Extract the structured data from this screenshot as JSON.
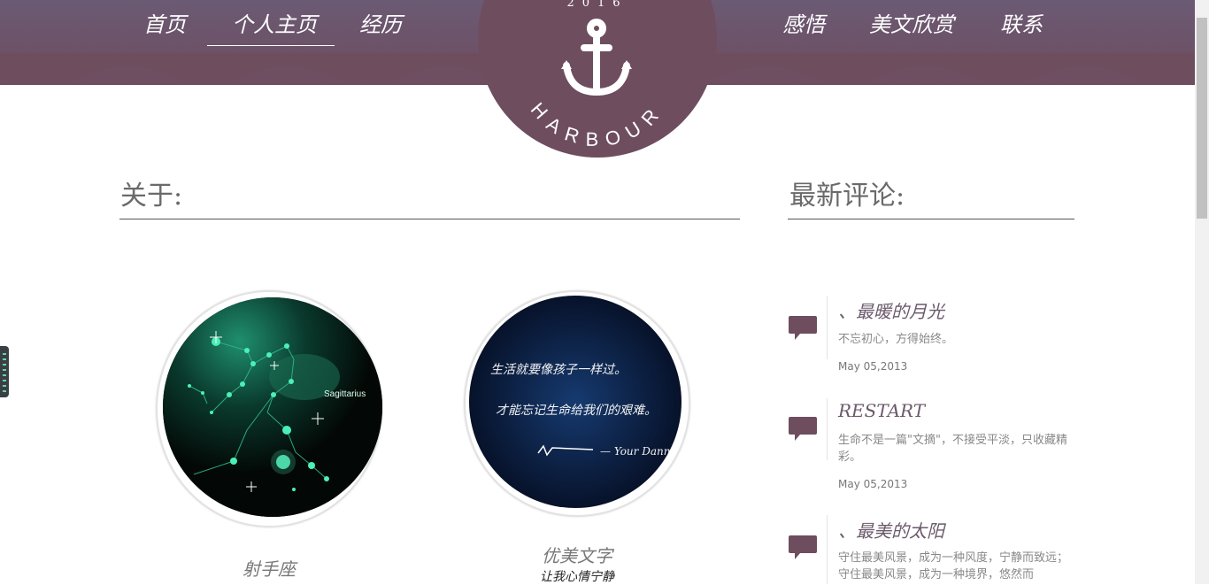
{
  "nav": {
    "left": [
      "首页",
      "个人主页",
      "经历"
    ],
    "right": [
      "感悟",
      "美文欣赏",
      "联系"
    ]
  },
  "logo": {
    "year": "2016",
    "name": "HARBOUR"
  },
  "about": {
    "title": "关于:",
    "items": [
      {
        "caption": "射手座",
        "image_label": "Sagittarius"
      },
      {
        "caption": "优美文字",
        "subcaption": "让我心情宁静",
        "image_text": [
          "生活就要像孩子一样过。",
          "才能忘记生命给我们的艰难。"
        ],
        "image_signature": "— Your Danny"
      }
    ]
  },
  "comments": {
    "title": "最新评论:",
    "items": [
      {
        "title": "、最暖的月光",
        "text": "不忘初心，方得始终。",
        "date": "May 05,2013"
      },
      {
        "title": "RESTART",
        "text": "生命不是一篇\"文摘\"，不接受平淡，只收藏精彩。",
        "date": "May 05,2013"
      },
      {
        "title": "、最美的太阳",
        "text": "守住最美风景，成为一种风度，宁静而致远；守住最美风景，成为一种境界，悠然而",
        "date": ""
      }
    ]
  },
  "colors": {
    "brand": "#6e4d5f",
    "header_top": "#6b5a74",
    "accent_glow": "#2fe0a6"
  }
}
